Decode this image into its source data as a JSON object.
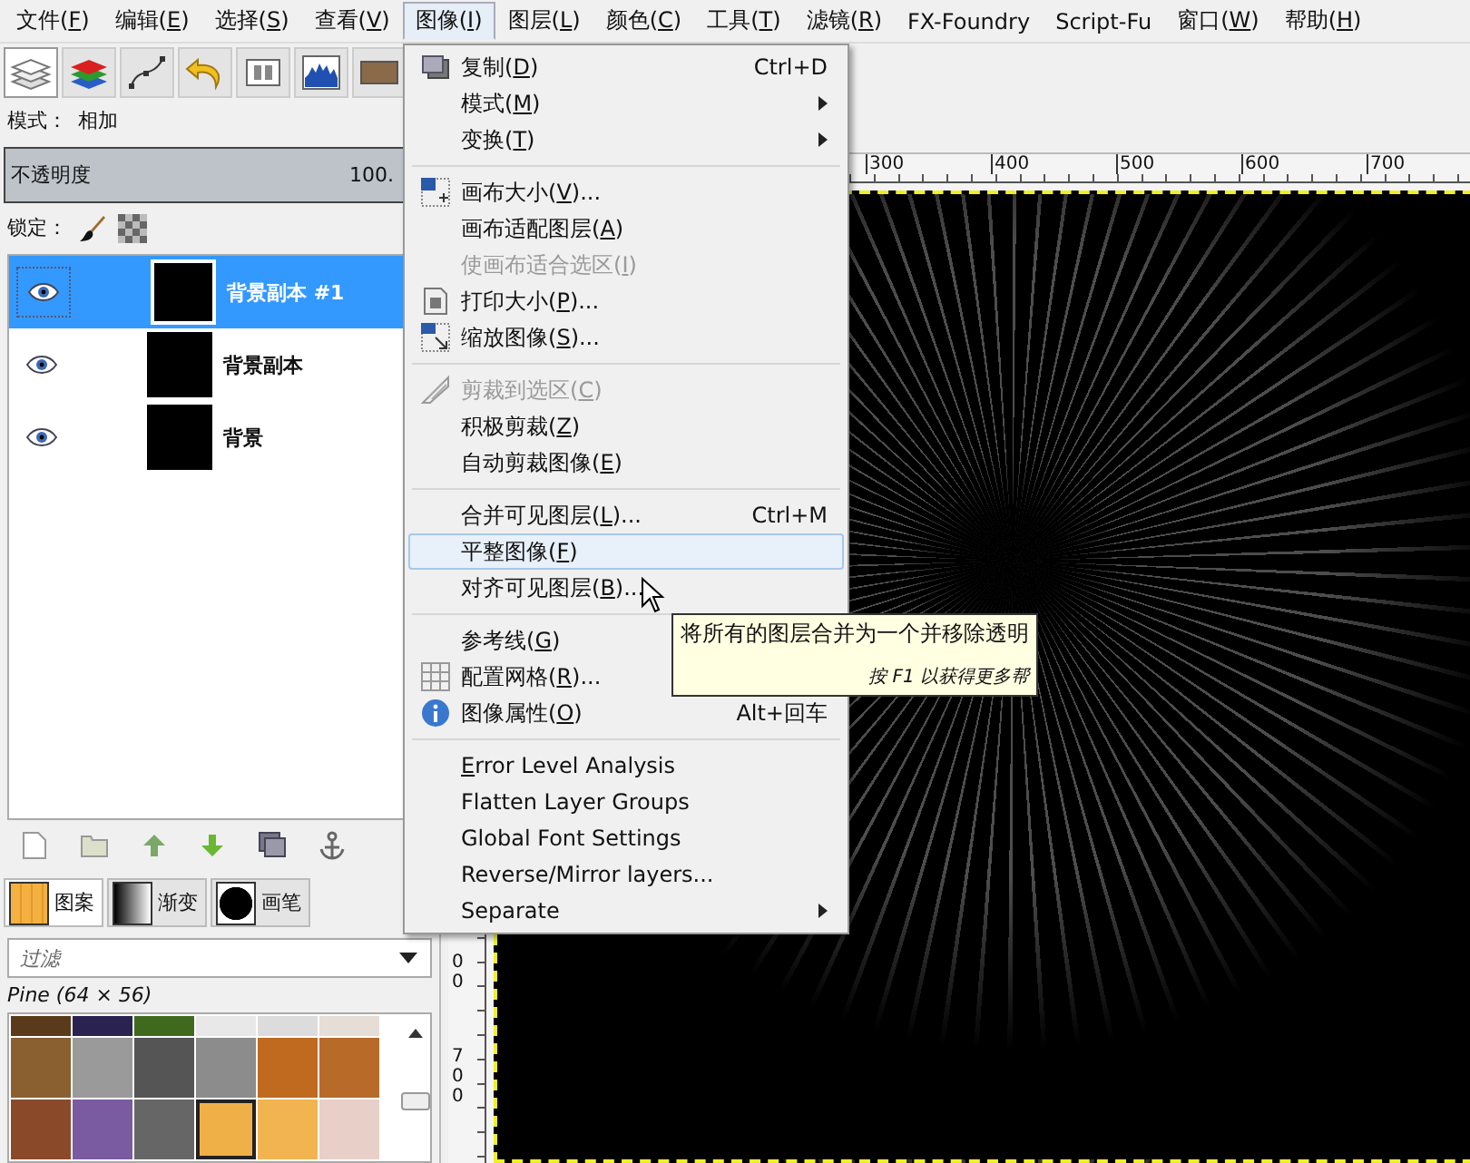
{
  "menubar": [
    {
      "pre": "文件(",
      "key": "F",
      "post": ")",
      "selected": false
    },
    {
      "pre": "编辑(",
      "key": "E",
      "post": ")",
      "selected": false
    },
    {
      "pre": "选择(",
      "key": "S",
      "post": ")",
      "selected": false
    },
    {
      "pre": "查看(",
      "key": "V",
      "post": ")",
      "selected": false
    },
    {
      "pre": "图像(",
      "key": "I",
      "post": ")",
      "selected": true
    },
    {
      "pre": "图层(",
      "key": "L",
      "post": ")",
      "selected": false
    },
    {
      "pre": "颜色(",
      "key": "C",
      "post": ")",
      "selected": false
    },
    {
      "pre": "工具(",
      "key": "T",
      "post": ")",
      "selected": false
    },
    {
      "pre": "滤镜(",
      "key": "R",
      "post": ")",
      "selected": false
    },
    {
      "pre": "FX-Foundry",
      "selected": false
    },
    {
      "pre": "Script-Fu",
      "selected": false
    },
    {
      "pre": "窗口(",
      "key": "W",
      "post": ")",
      "selected": false
    },
    {
      "pre": "帮助(",
      "key": "H",
      "post": ")",
      "selected": false
    }
  ],
  "dock_tabs": [
    {
      "selected": true
    },
    {
      "selected": false
    },
    {
      "selected": false
    },
    {
      "selected": false
    },
    {
      "selected": false
    },
    {
      "selected": false
    },
    {
      "selected": false
    }
  ],
  "layers_panel": {
    "mode_label": "模式：",
    "mode_value": "相加",
    "opacity": {
      "label": "不透明度",
      "value": "100.",
      "level": 1
    },
    "lock_label": "锁定：",
    "layers": [
      {
        "name": "背景副本 #1",
        "visible": true,
        "selected": true
      },
      {
        "name": "背景副本",
        "visible": true,
        "selected": false
      },
      {
        "name": "背景",
        "visible": true,
        "selected": false
      }
    ]
  },
  "resource_tabs": [
    {
      "label": "图案",
      "selected": true
    },
    {
      "label": "渐变",
      "selected": false
    },
    {
      "label": "画笔",
      "selected": false
    }
  ],
  "filter": {
    "placeholder": "过滤"
  },
  "pattern_name": "Pine (64 × 56)",
  "patterns": [
    {
      "color": "#5a3a1a",
      "selected": false
    },
    {
      "color": "#2a2250",
      "selected": false
    },
    {
      "color": "#3f6a1e",
      "selected": false
    },
    {
      "color": "#e8e8e8",
      "selected": false
    },
    {
      "color": "#dcdcdc",
      "selected": false
    },
    {
      "color": "#e6ddd6",
      "selected": false
    },
    {
      "color": "#8a6030",
      "selected": false
    },
    {
      "color": "#9a9a9a",
      "selected": false
    },
    {
      "color": "#555555",
      "selected": false
    },
    {
      "color": "#8c8c8c",
      "selected": false
    },
    {
      "color": "#c06a20",
      "selected": false
    },
    {
      "color": "#b86a28",
      "selected": false
    },
    {
      "color": "#8a4a2a",
      "selected": false
    },
    {
      "color": "#7a5aa0",
      "selected": false
    },
    {
      "color": "#666666",
      "selected": false
    },
    {
      "color": "#f0b048",
      "selected": true
    },
    {
      "color": "#f2b450",
      "selected": false
    },
    {
      "color": "#e8cfc8",
      "selected": false
    }
  ],
  "ruler": {
    "h_labels": [
      "300",
      "400",
      "500",
      "600",
      "700"
    ],
    "v_labels": [
      "00",
      "700"
    ]
  },
  "menu": [
    {
      "kind": "item",
      "pre": "复制(",
      "key": "D",
      "post": ")",
      "shortcut": "Ctrl+D",
      "submenu": false,
      "disabled": false,
      "selected": false
    },
    {
      "kind": "item",
      "pre": "模式(",
      "key": "M",
      "post": ")",
      "submenu": true,
      "disabled": false,
      "selected": false
    },
    {
      "kind": "item",
      "pre": "变换(",
      "key": "T",
      "post": ")",
      "submenu": true,
      "disabled": false,
      "selected": false
    },
    {
      "kind": "separator"
    },
    {
      "kind": "item",
      "pre": "画布大小(",
      "key": "V",
      "post": ")...",
      "submenu": false,
      "disabled": false,
      "selected": false
    },
    {
      "kind": "item",
      "pre": "画布适配图层(",
      "key": "A",
      "post": ")",
      "submenu": false,
      "disabled": false,
      "selected": false
    },
    {
      "kind": "item",
      "pre": "使画布适合选区(",
      "key": "I",
      "post": ")",
      "submenu": false,
      "disabled": true,
      "selected": false
    },
    {
      "kind": "item",
      "pre": "打印大小(",
      "key": "P",
      "post": ")...",
      "submenu": false,
      "disabled": false,
      "selected": false
    },
    {
      "kind": "item",
      "pre": "缩放图像(",
      "key": "S",
      "post": ")...",
      "submenu": false,
      "disabled": false,
      "selected": false
    },
    {
      "kind": "separator"
    },
    {
      "kind": "item",
      "pre": "剪裁到选区(",
      "key": "C",
      "post": ")",
      "submenu": false,
      "disabled": true,
      "selected": false
    },
    {
      "kind": "item",
      "pre": "积极剪裁(",
      "key": "Z",
      "post": ")",
      "submenu": false,
      "disabled": false,
      "selected": false
    },
    {
      "kind": "item",
      "pre": "自动剪裁图像(",
      "key": "E",
      "post": ")",
      "submenu": false,
      "disabled": false,
      "selected": false
    },
    {
      "kind": "separator"
    },
    {
      "kind": "item",
      "pre": "合并可见图层(",
      "key": "L",
      "post": ")...",
      "shortcut": "Ctrl+M",
      "submenu": false,
      "disabled": false,
      "selected": false
    },
    {
      "kind": "item",
      "pre": "平整图像(",
      "key": "F",
      "post": ")",
      "submenu": false,
      "disabled": false,
      "selected": true
    },
    {
      "kind": "item",
      "pre": "对齐可见图层(",
      "key": "B",
      "post": ")...",
      "submenu": false,
      "disabled": false,
      "selected": false
    },
    {
      "kind": "separator"
    },
    {
      "kind": "item",
      "pre": "参考线(",
      "key": "G",
      "post": ")",
      "submenu": false,
      "disabled": false,
      "selected": false
    },
    {
      "kind": "item",
      "pre": "配置网格(",
      "key": "R",
      "post": ")...",
      "submenu": false,
      "disabled": false,
      "selected": false
    },
    {
      "kind": "item",
      "pre": "图像属性(",
      "key": "O",
      "post": ")",
      "shortcut": "Alt+回车",
      "submenu": false,
      "disabled": false,
      "selected": false
    },
    {
      "kind": "separator"
    },
    {
      "kind": "item",
      "key": "E",
      "post": "rror Level Analysis",
      "submenu": false,
      "disabled": false,
      "selected": false
    },
    {
      "kind": "item",
      "pre": "Flatten Layer Groups",
      "submenu": false,
      "disabled": false,
      "selected": false
    },
    {
      "kind": "item",
      "pre": "Global Font Settings",
      "submenu": false,
      "disabled": false,
      "selected": false
    },
    {
      "kind": "item",
      "pre": "Reverse/Mirror layers...",
      "submenu": false,
      "disabled": false,
      "selected": false
    },
    {
      "kind": "item",
      "pre": "Separate",
      "submenu": true,
      "disabled": false,
      "selected": false
    }
  ],
  "tooltip": {
    "text": "将所有的图层合并为一个并移除透明",
    "hint": "按 F1 以获得更多帮"
  }
}
